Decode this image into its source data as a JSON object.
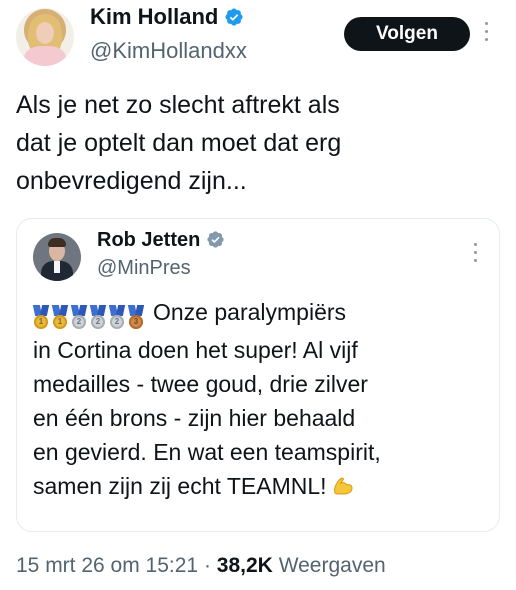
{
  "author": {
    "name": "Kim Holland",
    "handle": "@KimHollandxx",
    "follow_label": "Volgen"
  },
  "post": {
    "text_lines": [
      "Als je net zo slecht aftrekt als",
      "dat je optelt dan moet dat erg",
      "onbevredigend zijn..."
    ]
  },
  "quoted": {
    "name": "Rob Jetten",
    "handle": "@MinPres",
    "medals": [
      "gold",
      "gold",
      "silver",
      "silver",
      "silver",
      "bronze"
    ],
    "medal_numbers": [
      "1",
      "1",
      "2",
      "2",
      "2",
      "3"
    ],
    "text_lines": [
      "Onze paralympiërs",
      "in Cortina doen het super! Al vijf",
      "medailles - twee goud, drie zilver",
      "en één brons - zijn hier behaald",
      "en gevierd. En wat een teamspirit,",
      "samen zijn zij echt TEAMNL!"
    ]
  },
  "meta": {
    "datetime": "15 mrt 26 om 15:21",
    "separator": "·",
    "views_count": "38,2K",
    "views_label": "Weergaven"
  },
  "colors": {
    "verified_blue": "#1d9bf0",
    "verified_gray": "#829aab",
    "follow_button_bg": "#0f1419",
    "secondary_text": "#536471"
  },
  "icons": [
    "verified-badge-icon",
    "verified-gray-badge-icon",
    "more-options-icon",
    "medal-icon",
    "flexed-biceps-icon"
  ]
}
